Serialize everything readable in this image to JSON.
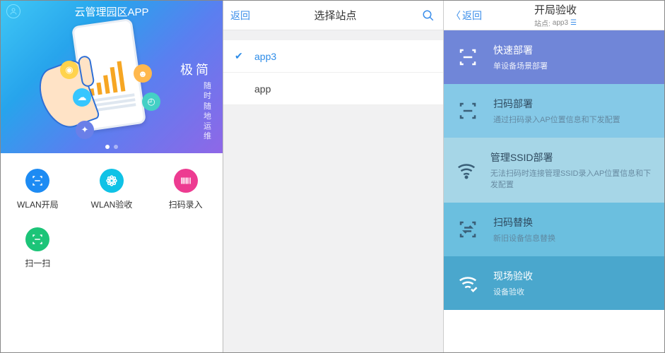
{
  "left": {
    "title": "云管理园区APP",
    "slogan_big": "极简",
    "slogan_small": [
      "随",
      "时",
      "随",
      "地",
      "运",
      "维"
    ],
    "grid": [
      {
        "label": "WLAN开局",
        "color": "c-blue",
        "icon": "scan"
      },
      {
        "label": "WLAN验收",
        "color": "c-cyan",
        "icon": "flower"
      },
      {
        "label": "扫码录入",
        "color": "c-pink",
        "icon": "barcode"
      },
      {
        "label": "扫一扫",
        "color": "c-green",
        "icon": "scan"
      }
    ]
  },
  "mid": {
    "back": "返回",
    "title": "选择站点",
    "items": [
      {
        "label": "app3",
        "selected": true
      },
      {
        "label": "app",
        "selected": false
      }
    ]
  },
  "right": {
    "back": "返回",
    "title": "开局验收",
    "subtitle_prefix": "站点:",
    "subtitle_site": "app3",
    "options": [
      {
        "t1": "快速部署",
        "t2": "单设备场景部署",
        "icon": "scan",
        "cls": "o1"
      },
      {
        "t1": "扫码部署",
        "t2": "通过扫码录入AP位置信息和下发配置",
        "icon": "scan",
        "cls": "o2"
      },
      {
        "t1": "管理SSID部署",
        "t2": "无法扫码时连接管理SSID录入AP位置信息和下发配置",
        "icon": "wifi",
        "cls": "o3"
      },
      {
        "t1": "扫码替换",
        "t2": "新旧设备信息替换",
        "icon": "swap",
        "cls": "o4"
      },
      {
        "t1": "现场验收",
        "t2": "设备验收",
        "icon": "wifi-check",
        "cls": "o5"
      }
    ]
  }
}
